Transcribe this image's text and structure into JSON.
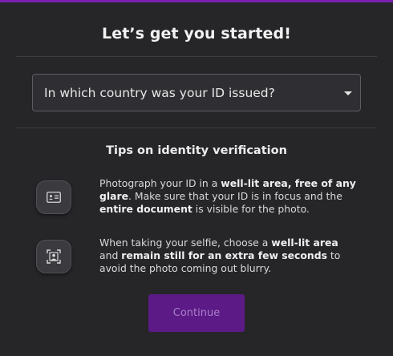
{
  "header": {
    "title": "Let’s get you started!"
  },
  "country_select": {
    "placeholder": "In which country was your ID issued?"
  },
  "tips": {
    "heading": "Tips on identity verification",
    "items": [
      {
        "icon": "id-card-icon",
        "segments": [
          {
            "text": "Photograph your ID in a ",
            "bold": false
          },
          {
            "text": "well-lit area, free of any glare",
            "bold": true
          },
          {
            "text": ". Make sure that your ID is in focus and the ",
            "bold": false
          },
          {
            "text": "entire document",
            "bold": true
          },
          {
            "text": " is visible for the photo.",
            "bold": false
          }
        ]
      },
      {
        "icon": "selfie-frame-icon",
        "segments": [
          {
            "text": "When taking your selfie, choose a ",
            "bold": false
          },
          {
            "text": "well-lit area",
            "bold": true
          },
          {
            "text": " and ",
            "bold": false
          },
          {
            "text": "remain still for an extra few seconds",
            "bold": true
          },
          {
            "text": " to avoid the photo coming out blurry.",
            "bold": false
          }
        ]
      }
    ]
  },
  "actions": {
    "continue_label": "Continue",
    "continue_disabled": true
  },
  "colors": {
    "accent": "#7a1fb0",
    "button_bg": "#5c1a87",
    "background": "#262629"
  }
}
